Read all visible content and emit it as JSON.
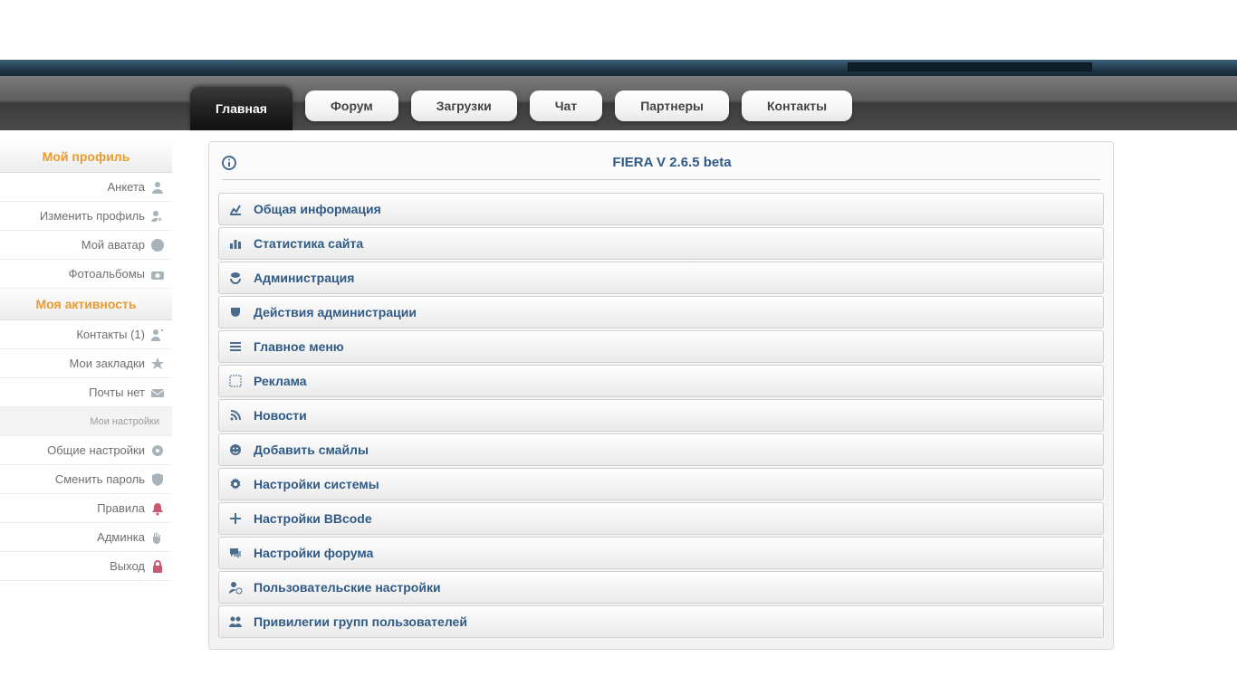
{
  "nav": {
    "active": "Главная",
    "tabs": [
      "Форум",
      "Загрузки",
      "Чат",
      "Партнеры",
      "Контакты"
    ]
  },
  "sidebar": {
    "profile_header": "Мой профиль",
    "profile_items": [
      {
        "label": "Анкета",
        "icon": "user"
      },
      {
        "label": "Изменить профиль",
        "icon": "pencil-user"
      },
      {
        "label": "Мой аватар",
        "icon": "face"
      },
      {
        "label": "Фотоальбомы",
        "icon": "camera"
      }
    ],
    "activity_header": "Моя активность",
    "activity_items": [
      {
        "label": "Контакты (1)",
        "icon": "add-user"
      },
      {
        "label": "Мои закладки",
        "icon": "star"
      },
      {
        "label": "Почты нет",
        "icon": "mail"
      }
    ],
    "settings_header": "Мои настройки",
    "settings_items": [
      {
        "label": "Общие настройки",
        "icon": "gear"
      },
      {
        "label": "Сменить пароль",
        "icon": "shield"
      },
      {
        "label": "Правила",
        "icon": "bell",
        "red": true
      },
      {
        "label": "Админка",
        "icon": "hand"
      },
      {
        "label": "Выход",
        "icon": "lock",
        "red": true
      }
    ]
  },
  "main": {
    "title": "FIERA V 2.6.5 beta",
    "items": [
      {
        "label": "Общая информация",
        "icon": "chart"
      },
      {
        "label": "Статистика сайта",
        "icon": "bars"
      },
      {
        "label": "Администрация",
        "icon": "person-badge"
      },
      {
        "label": "Действия администрации",
        "icon": "mask"
      },
      {
        "label": "Главное меню",
        "icon": "menu"
      },
      {
        "label": "Реклама",
        "icon": "target"
      },
      {
        "label": "Новости",
        "icon": "rss"
      },
      {
        "label": "Добавить смайлы",
        "icon": "smile"
      },
      {
        "label": "Настройки системы",
        "icon": "cog"
      },
      {
        "label": "Настройки BBcode",
        "icon": "arrows"
      },
      {
        "label": "Настройки форума",
        "icon": "chat"
      },
      {
        "label": "Пользовательские настройки",
        "icon": "user-cog"
      },
      {
        "label": "Привилегии групп пользователей",
        "icon": "group"
      }
    ]
  }
}
